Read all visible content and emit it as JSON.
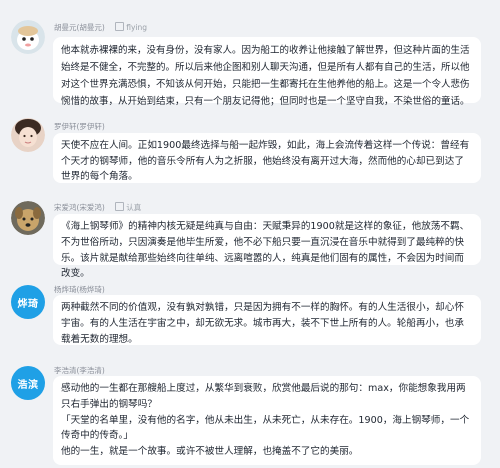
{
  "comments": [
    {
      "author": "胡曼元(胡曼元)",
      "tag": "flying",
      "text": "他本就赤裸裸的来，没有身份，没有家人。因为船工的收养让他接触了解世界，但这种片面的生活始终是不健全，不完整的。所以后来他企图和别人聊天沟通，但是所有人都有自己的生活，所以他对这个世界充满恐惧，不知该从何开始，只能把一生都寄托在生他养他的船上。这是一个令人悲伤惋惜的故事，从开始到结束，只有一个朋友记得他；但同时也是一个坚守自我，不染世俗的童话。"
    },
    {
      "author": "罗伊轩(罗伊轩)",
      "tag": "",
      "text": "天使不应在人间。正如1900最终选择与船一起炸毁，如此，海上会流传着这样一个传说：曾经有个天才的钢琴师，他的音乐令所有人为之折服，他始终没有离开过大海，然而他的心却已到达了世界的每个角落。"
    },
    {
      "author": "宋爱鸿(宋爱鸿)",
      "tag": "认真",
      "text": "《海上钢琴师》的精神内核无疑是纯真与自由：天赋秉异的1900就是这样的象征，他放荡不羁、不为世俗所动，只因演奏是他毕生所爱，他不必下船只要一直沉浸在音乐中就得到了最纯粹的快乐。该片就是献给那些始终向往单纯、远离喧嚣的人，纯真是他们固有的属性，不会因为时间而改变。"
    },
    {
      "author": "杨烨琦(杨烨琦)",
      "tag": "",
      "text": "两种截然不同的价值观，没有孰对孰错，只是因为拥有不一样的胸怀。有的人生活很小，却心怀宇宙。有的人生活在宇宙之中，却无欲无求。城市再大，装不下世上所有的人。轮船再小，也承载着无数的理想。"
    },
    {
      "author": "李浩清(李浩清)",
      "tag": "",
      "text": "感动他的一生都在那艘船上度过，从繁华到衰败，欣赏他最后说的那句：max，你能想象我用两只右手弹出的钢琴吗？\n「天堂的名单里，没有他的名字，他从未出生，从未死亡，从未存在。1900，海上钢琴师，一个传奇中的传奇。」\n他的一生，就是一个故事。或许不被世人理解，也掩盖不了它的美丽。"
    }
  ],
  "avatars": {
    "c4_initials": "烨琦",
    "c5_initials": "浩滨"
  },
  "colors": {
    "avatar_text_bg": "#1fa0e6",
    "bubble_bg": "#ffffff",
    "page_bg": "#f0f2f5"
  }
}
